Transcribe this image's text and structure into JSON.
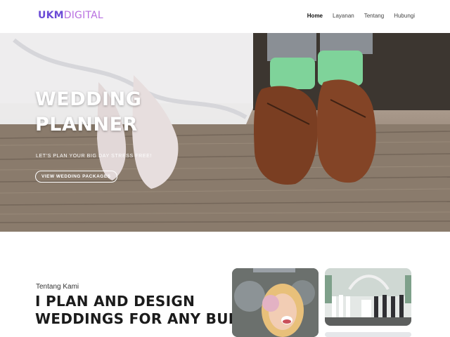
{
  "header": {
    "logo_primary": "UKM",
    "logo_secondary": "DIGITAL",
    "nav": [
      {
        "label": "Home",
        "active": true
      },
      {
        "label": "Layanan",
        "active": false
      },
      {
        "label": "Tentang",
        "active": false
      },
      {
        "label": "Hubungi",
        "active": false
      }
    ]
  },
  "hero": {
    "title_line1": "WEDDING",
    "title_line2": "PLANNER",
    "subtitle": "LET'S PLAN YOUR BIG DAY STRESS FREE!",
    "button_label": "VIEW WEDDING PACKAGES"
  },
  "about": {
    "kicker": "Tentang Kami",
    "title_line1": "I PLAN AND DESIGN",
    "title_line2": "WEDDINGS FOR ANY BUDGET"
  },
  "colors": {
    "logo_primary": "#6b4bd6",
    "logo_secondary": "#b86fe0",
    "accent_sock": "#7fd39a",
    "shoe_brown": "#7a3e22"
  }
}
